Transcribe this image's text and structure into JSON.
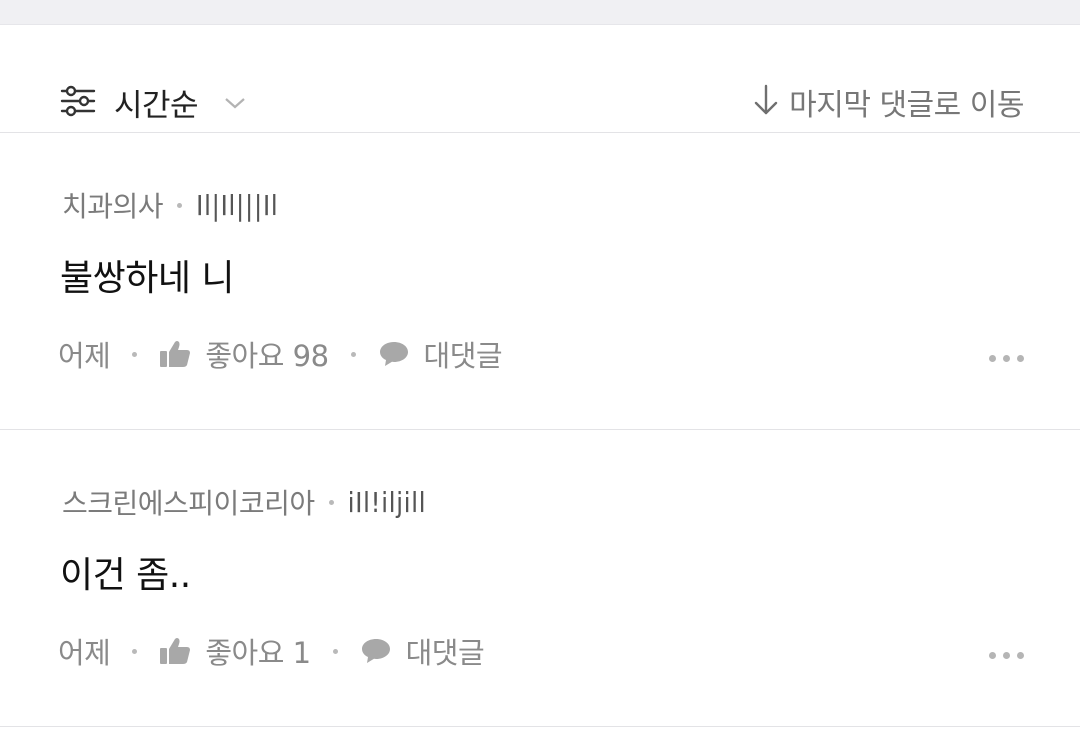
{
  "toolbar": {
    "sort_label": "시간순",
    "sort_icon": "sliders-icon",
    "sort_chevron": "chevron-down-icon",
    "jump_label": "마지막 댓글로 이동",
    "jump_icon": "arrow-down-icon"
  },
  "comments": [
    {
      "author": "치과의사",
      "badge": "Il|Il|||Il",
      "text": "불쌍하네 니",
      "time": "어제",
      "like_label": "좋아요 98",
      "reply_label": "대댓글"
    },
    {
      "author": "스크린에스피이코리아",
      "badge": "iIl!iljill",
      "text": "이건 좀..",
      "time": "어제",
      "like_label": "좋아요 1",
      "reply_label": "대댓글"
    }
  ],
  "colors": {
    "text_primary": "#111111",
    "text_secondary": "#8a8a8a",
    "divider": "#e3e3e6",
    "top_strip": "#f0f0f3"
  }
}
